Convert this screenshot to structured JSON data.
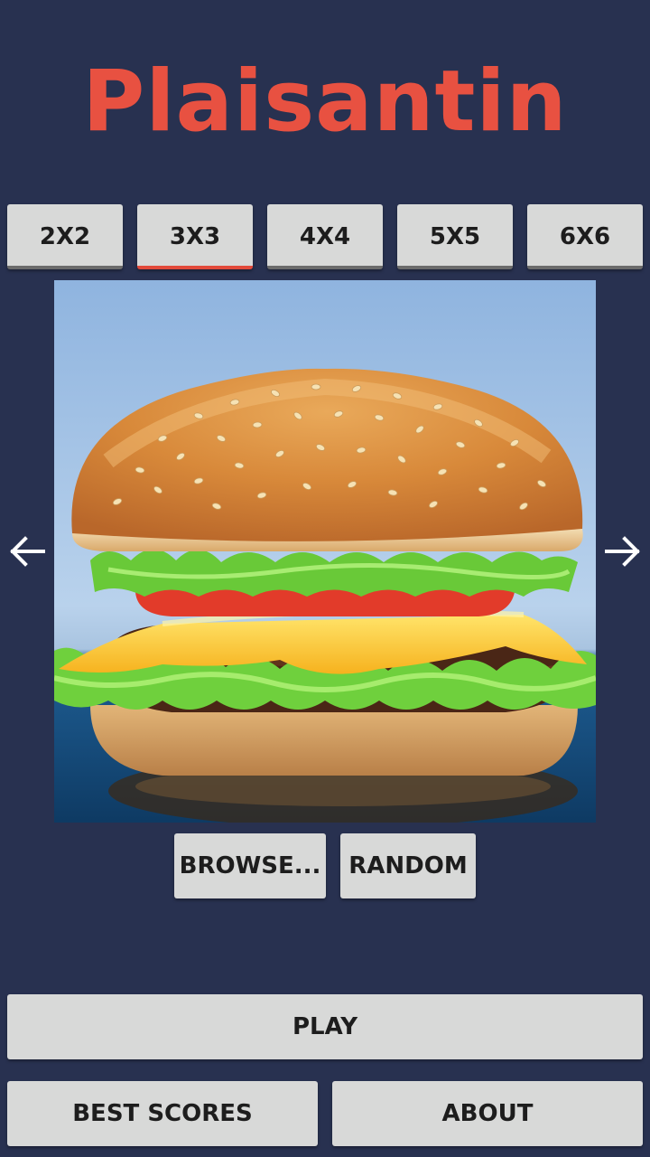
{
  "app": {
    "title": "Plaisantin"
  },
  "grid_sizes": [
    {
      "label": "2X2",
      "selected": false
    },
    {
      "label": "3X3",
      "selected": true
    },
    {
      "label": "4X4",
      "selected": false
    },
    {
      "label": "5X5",
      "selected": false
    },
    {
      "label": "6X6",
      "selected": false
    }
  ],
  "preview": {
    "image": "burger-photo",
    "prev_icon": "arrow-left-icon",
    "next_icon": "arrow-right-icon"
  },
  "image_actions": {
    "browse_label": "BROWSE...",
    "random_label": "RANDOM"
  },
  "footer": {
    "play_label": "PLAY",
    "best_scores_label": "BEST SCORES",
    "about_label": "ABOUT"
  },
  "colors": {
    "background": "#283150",
    "title": "#e85141",
    "button": "#d8d9d8",
    "selected_underline": "#e24a3b"
  }
}
